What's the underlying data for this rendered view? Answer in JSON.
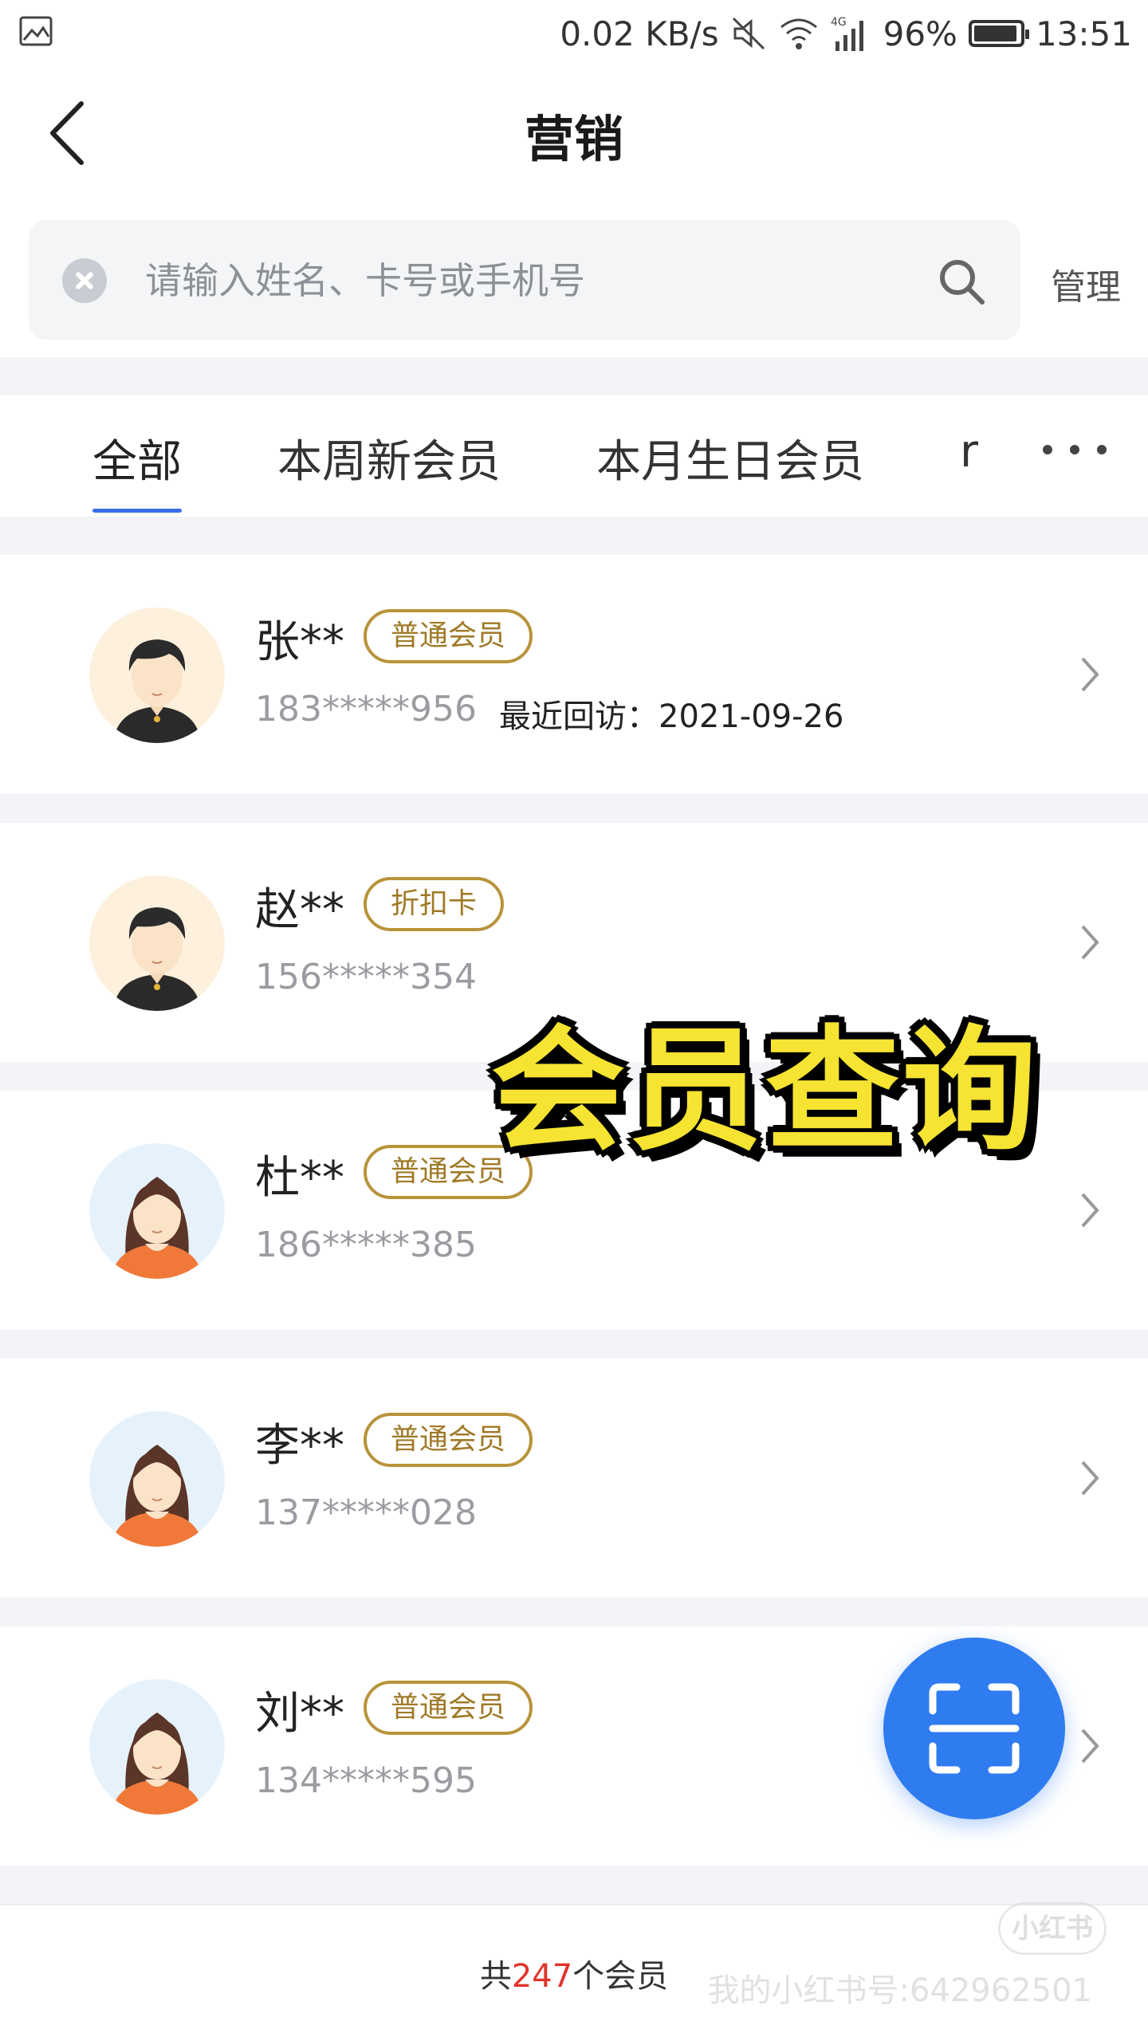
{
  "status_bar": {
    "net_speed": "0.02 KB/s",
    "network": "4G",
    "battery": "96%",
    "time": "13:51"
  },
  "nav": {
    "title": "营销"
  },
  "search": {
    "placeholder": "请输入姓名、卡号或手机号",
    "manage_label": "管理"
  },
  "tabs": [
    {
      "label": "全部",
      "active": true
    },
    {
      "label": "本周新会员"
    },
    {
      "label": "本月生日会员"
    },
    {
      "label": "r"
    }
  ],
  "members": [
    {
      "name": "张**",
      "badge": "普通会员",
      "phone": "183*****956",
      "visit": "最近回访：2021-09-26",
      "gender": "male"
    },
    {
      "name": "赵**",
      "badge": "折扣卡",
      "phone": "156*****354",
      "visit": "",
      "gender": "male"
    },
    {
      "name": "杜**",
      "badge": "普通会员",
      "phone": "186*****385",
      "visit": "",
      "gender": "female"
    },
    {
      "name": "李**",
      "badge": "普通会员",
      "phone": "137*****028",
      "visit": "",
      "gender": "female"
    },
    {
      "name": "刘**",
      "badge": "普通会员",
      "phone": "134*****595",
      "visit": "",
      "gender": "female"
    }
  ],
  "caption": "会员查询",
  "footer": {
    "prefix": "共",
    "count": "247",
    "suffix": "个会员"
  },
  "watermark": {
    "logo": "小红书",
    "text": "我的小红书号:642962501"
  },
  "colors": {
    "accent": "#3a6fe8",
    "fab": "#2f7cf0",
    "badge": "#b8933a",
    "count": "#e0342b",
    "caption": "#f6e332"
  }
}
